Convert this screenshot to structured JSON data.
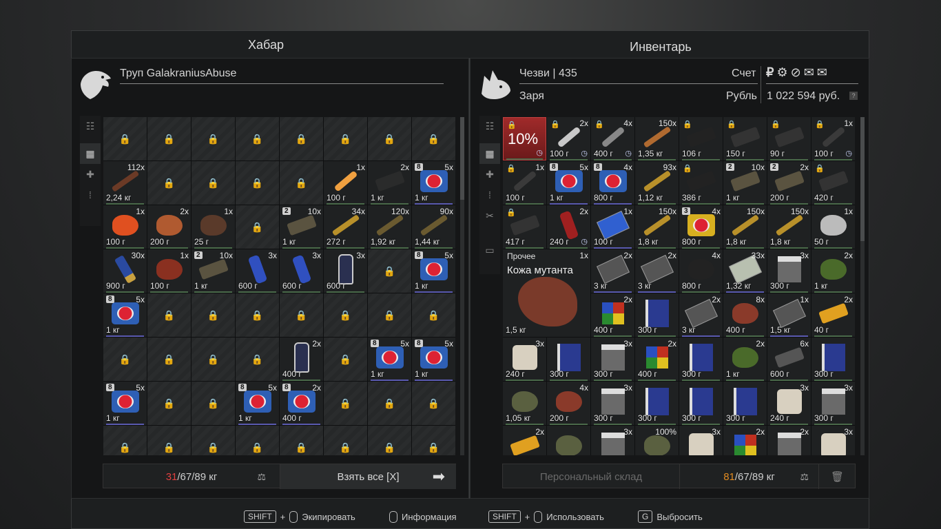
{
  "loot": {
    "title": "Хабар",
    "container_name": "Труп GalakraniusAbuse",
    "weight_current": "31",
    "weight_rest": "/67/89 кг",
    "take_all": "Взять все [X]",
    "rows": [
      [
        {
          "locked": true
        },
        {
          "locked": true
        },
        {
          "locked": true
        },
        {
          "locked": true
        },
        {
          "locked": true
        },
        {
          "locked": true
        },
        {
          "locked": true
        },
        {
          "locked": true
        }
      ],
      [
        {
          "qty": "112x",
          "w": "2,24 кг",
          "shape": "ammo",
          "color": "#6b3a26"
        },
        {
          "locked": true
        },
        {
          "locked": true
        },
        {
          "locked": true
        },
        {
          "locked": true
        },
        {
          "qty": "1x",
          "w": "100 г",
          "shape": "stick",
          "color": "#f0a040"
        },
        {
          "qty": "2x",
          "w": "1 кг",
          "shape": "bar",
          "color": "#2a2b2b"
        },
        {
          "qty": "5x",
          "w": "1 кг",
          "shape": "medkit",
          "lvl": "8"
        }
      ],
      [
        {
          "qty": "1x",
          "w": "100 г",
          "shape": "blob",
          "color": "#e05020"
        },
        {
          "qty": "2x",
          "w": "200 г",
          "shape": "blob",
          "color": "#b05a30"
        },
        {
          "qty": "1x",
          "w": "25 г",
          "shape": "blob",
          "color": "#5a3a2a"
        },
        {
          "locked": true
        },
        {
          "qty": "10x",
          "w": "1 кг",
          "shape": "bar",
          "color": "#5a5340",
          "lvl": "2"
        },
        {
          "qty": "34x",
          "w": "272 г",
          "shape": "ammo",
          "color": "#b8902a"
        },
        {
          "qty": "120x",
          "w": "1,92 кг",
          "shape": "ammo",
          "color": "#6a5a30"
        },
        {
          "qty": "90x",
          "w": "1,44 кг",
          "shape": "ammo",
          "color": "#6a5a30"
        }
      ],
      [
        {
          "qty": "30x",
          "w": "900 г",
          "shape": "shell",
          "color": "#2a4aa0"
        },
        {
          "qty": "1x",
          "w": "100 г",
          "shape": "blob",
          "color": "#8a3020"
        },
        {
          "qty": "10x",
          "w": "1 кг",
          "shape": "bar",
          "color": "#5a5340",
          "lvl": "2"
        },
        {
          "qty": "3x",
          "w": "600 г",
          "shape": "can",
          "color": "#3050c0"
        },
        {
          "qty": "3x",
          "w": "600 г",
          "shape": "can",
          "color": "#3050c0"
        },
        {
          "qty": "3x",
          "w": "600 г",
          "shape": "bottle",
          "color": "#2a3050"
        },
        {
          "locked": true
        },
        {
          "qty": "5x",
          "w": "1 кг",
          "shape": "medkit",
          "lvl": "8"
        }
      ],
      [
        {
          "qty": "5x",
          "w": "1 кг",
          "shape": "medkit",
          "lvl": "8"
        },
        {
          "locked": true
        },
        {
          "locked": true
        },
        {
          "locked": true
        },
        {
          "locked": true
        },
        {
          "locked": true
        },
        {
          "locked": true
        },
        {
          "locked": true
        }
      ],
      [
        {
          "locked": true
        },
        {
          "locked": true
        },
        {
          "locked": true
        },
        {
          "locked": true
        },
        {
          "qty": "2x",
          "w": "400 г",
          "shape": "bottle",
          "color": "#2a3050"
        },
        {
          "locked": true
        },
        {
          "qty": "5x",
          "w": "1 кг",
          "shape": "medkit",
          "lvl": "8"
        },
        {
          "qty": "5x",
          "w": "1 кг",
          "shape": "medkit",
          "lvl": "8"
        }
      ],
      [
        {
          "qty": "5x",
          "w": "1 кг",
          "shape": "medkit",
          "lvl": "8"
        },
        {
          "locked": true
        },
        {
          "locked": true
        },
        {
          "qty": "5x",
          "w": "1 кг",
          "shape": "medkit",
          "lvl": "8"
        },
        {
          "qty": "2x",
          "w": "400 г",
          "shape": "medkit",
          "lvl": "8"
        },
        {
          "locked": true
        },
        {
          "locked": true
        },
        {
          "locked": true
        }
      ],
      [
        {
          "locked": true
        },
        {
          "locked": true
        },
        {
          "locked": true
        },
        {
          "locked": true
        },
        {
          "locked": true
        },
        {
          "locked": true
        },
        {
          "locked": true
        },
        {
          "locked": true
        }
      ]
    ]
  },
  "inventory": {
    "title": "Инвентарь",
    "player": "Чезви | 435",
    "faction": "Заря",
    "account_label": "Счет",
    "currency_label": "Рубль",
    "balance": "1 022 594 руб.",
    "currency_icons": [
      "ruble-icon",
      "gear-icon",
      "compass-icon",
      "doc-icon",
      "doc-icon"
    ],
    "stash_button": "Персональный склад",
    "weight_current": "81",
    "weight_rest": "/67/89 кг",
    "big_item": {
      "category": "Прочее",
      "name": "Кожа мутанта",
      "qty": "1x",
      "w": "1,5 кг"
    },
    "rows": [
      [
        {
          "percent": "10%",
          "ilock": true,
          "clock": true,
          "color": "#7a2020"
        },
        {
          "qty": "2x",
          "w": "100 г",
          "ilock": true,
          "clock": true,
          "shape": "stick",
          "color": "#c8c8c8"
        },
        {
          "qty": "4x",
          "w": "400 г",
          "ilock": true,
          "clock": true,
          "shape": "stick",
          "color": "#888"
        },
        {
          "qty": "150x",
          "w": "1,35 кг",
          "shape": "ammo",
          "color": "#b06a30"
        },
        {
          "w": "106 г",
          "ilock": true,
          "shape": "bar",
          "color": "#222"
        },
        {
          "w": "150 г",
          "ilock": true,
          "shape": "bar",
          "color": "#333"
        },
        {
          "w": "90 г",
          "ilock": true,
          "shape": "bar",
          "color": "#333"
        },
        {
          "qty": "1x",
          "w": "100 г",
          "ilock": true,
          "clock": true,
          "shape": "stick",
          "color": "#3a3a3a"
        }
      ],
      [
        {
          "qty": "1x",
          "w": "100 г",
          "ilock": true,
          "shape": "stick",
          "color": "#3a3a3a"
        },
        {
          "qty": "5x",
          "w": "1 кг",
          "shape": "medkit",
          "lvl": "8"
        },
        {
          "qty": "4x",
          "w": "800 г",
          "shape": "medkit",
          "lvl": "8"
        },
        {
          "qty": "93x",
          "w": "1,12 кг",
          "shape": "ammo",
          "color": "#b8902a"
        },
        {
          "w": "386 г",
          "ilock": true,
          "shape": "bar",
          "color": "#222"
        },
        {
          "qty": "10x",
          "w": "1 кг",
          "shape": "bar",
          "color": "#5a5340",
          "lvl": "2"
        },
        {
          "qty": "2x",
          "w": "200 г",
          "shape": "bar",
          "color": "#5a5340",
          "lvl": "2"
        },
        {
          "w": "420 г",
          "ilock": true,
          "shape": "bar",
          "color": "#333"
        }
      ],
      [
        {
          "w": "417 г",
          "ilock": true,
          "shape": "bar",
          "color": "#333"
        },
        {
          "qty": "2x",
          "w": "240 г",
          "clock": true,
          "shape": "can",
          "color": "#a02020"
        },
        {
          "qty": "1x",
          "w": "100 г",
          "shape": "card",
          "color": "#3060d0"
        },
        {
          "qty": "150x",
          "w": "1,8 кг",
          "shape": "ammo",
          "color": "#b8902a"
        },
        {
          "qty": "4x",
          "w": "800 г",
          "shape": "medkit-y",
          "lvl": "3"
        },
        {
          "qty": "150x",
          "w": "1,8 кг",
          "shape": "ammo",
          "color": "#b8902a"
        },
        {
          "qty": "150x",
          "w": "1,8 кг",
          "shape": "ammo",
          "color": "#b8902a"
        },
        {
          "qty": "1x",
          "w": "50 г",
          "shape": "blob",
          "color": "#bbb"
        }
      ],
      [
        {
          "big": true
        },
        {
          "big": true
        },
        {
          "qty": "2x",
          "w": "3 кг",
          "shape": "card",
          "color": "#555"
        },
        {
          "qty": "2x",
          "w": "3 кг",
          "shape": "card",
          "color": "#555"
        },
        {
          "qty": "4x",
          "w": "800 г",
          "shape": "blob",
          "color": "#222"
        },
        {
          "qty": "33x",
          "w": "1,32 кг",
          "shape": "card",
          "color": "#b8c0b0"
        },
        {
          "qty": "3x",
          "w": "300 г",
          "shape": "box",
          "color": "#6a6a6a"
        },
        {
          "qty": "2x",
          "w": "1 кг",
          "shape": "blob",
          "color": "#4a6a2a"
        }
      ],
      [
        {
          "big": true
        },
        {
          "big": true
        },
        {
          "qty": "2x",
          "w": "400 г",
          "shape": "cube",
          "color": "#b03020"
        },
        {
          "w": "300 г",
          "shape": "book",
          "color": "#2a3a90"
        },
        {
          "qty": "2x",
          "w": "3 кг",
          "shape": "card",
          "color": "#555"
        },
        {
          "qty": "8x",
          "w": "400 г",
          "shape": "blob",
          "color": "#8a3a2a"
        },
        {
          "qty": "1x",
          "w": "1,5 кг",
          "shape": "card",
          "color": "#555"
        },
        {
          "qty": "2x",
          "w": "40 г",
          "shape": "bar",
          "color": "#e0a020"
        }
      ],
      [
        {
          "qty": "3x",
          "w": "240 г",
          "shape": "roll",
          "color": "#d8d0c0"
        },
        {
          "w": "300 г",
          "shape": "book",
          "color": "#2a3a90"
        },
        {
          "qty": "3x",
          "w": "300 г",
          "shape": "box",
          "color": "#6a6a6a"
        },
        {
          "qty": "2x",
          "w": "400 г",
          "shape": "cube",
          "color": "#b03020"
        },
        {
          "w": "300 г",
          "shape": "book",
          "color": "#2a3a90"
        },
        {
          "qty": "2x",
          "w": "1 кг",
          "shape": "blob",
          "color": "#4a6a2a"
        },
        {
          "qty": "6x",
          "w": "600 г",
          "shape": "bar",
          "color": "#555"
        },
        {
          "w": "300 г",
          "shape": "book",
          "color": "#2a3a90"
        }
      ],
      [
        {
          "w": "1,05 кг",
          "shape": "blob",
          "color": "#5a6040"
        },
        {
          "qty": "4x",
          "w": "200 г",
          "shape": "blob",
          "color": "#8a3a2a"
        },
        {
          "qty": "3x",
          "w": "300 г",
          "shape": "box",
          "color": "#6a6a6a"
        },
        {
          "w": "300 г",
          "shape": "book",
          "color": "#2a3a90"
        },
        {
          "w": "300 г",
          "shape": "book",
          "color": "#2a3a90"
        },
        {
          "w": "300 г",
          "shape": "book",
          "color": "#2a3a90"
        },
        {
          "qty": "3x",
          "w": "240 г",
          "shape": "roll",
          "color": "#d8d0c0"
        },
        {
          "qty": "3x",
          "w": "300 г",
          "shape": "box",
          "color": "#6a6a6a"
        }
      ],
      [
        {
          "qty": "2x",
          "shape": "bar",
          "color": "#e0a020"
        },
        {
          "shape": "blob",
          "color": "#5a6040"
        },
        {
          "qty": "3x",
          "shape": "box",
          "color": "#6a6a6a"
        },
        {
          "percent2": "100%",
          "shape": "blob",
          "color": "#5a6040"
        },
        {
          "qty": "3x",
          "shape": "roll",
          "color": "#d8d0c0"
        },
        {
          "qty": "2x",
          "shape": "cube",
          "color": "#b03020"
        },
        {
          "qty": "2x",
          "shape": "box",
          "color": "#6a6a6a"
        },
        {
          "qty": "3x",
          "shape": "roll",
          "color": "#d8d0c0"
        }
      ]
    ]
  },
  "footer": {
    "shift_key": "SHIFT",
    "equip": "Экипировать",
    "info": "Информация",
    "use": "Использовать",
    "g_key": "G",
    "drop": "Выбросить"
  }
}
